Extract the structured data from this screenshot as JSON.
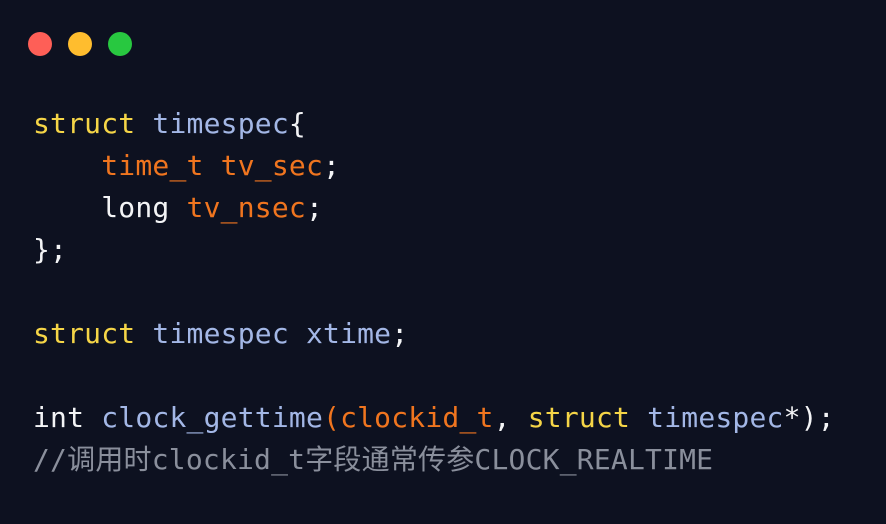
{
  "window": {
    "buttons": [
      {
        "name": "close",
        "color": "#fe5f57"
      },
      {
        "name": "minimize",
        "color": "#ffbd2e"
      },
      {
        "name": "maximize",
        "color": "#28c840"
      }
    ]
  },
  "code": {
    "colors": {
      "keyword": "#f5d547",
      "type": "#a3b7e6",
      "identifier": "#f0751f",
      "plain": "#f3f4f6",
      "comment": "#8a8f9c",
      "background": "#0d1120"
    },
    "lines": [
      {
        "tokens": [
          "struct",
          " ",
          "timespec",
          "{"
        ]
      },
      {
        "tokens": [
          "    ",
          "time_t",
          " ",
          "tv_sec",
          ";"
        ]
      },
      {
        "tokens": [
          "    ",
          "long",
          " ",
          "tv_nsec",
          ";"
        ]
      },
      {
        "tokens": [
          "};"
        ]
      },
      {
        "tokens": []
      },
      {
        "tokens": [
          "struct",
          " ",
          "timespec",
          " ",
          "xtime",
          ";"
        ]
      },
      {
        "tokens": []
      },
      {
        "tokens": [
          "int",
          " ",
          "clock_gettime",
          "(",
          "clockid_t",
          ", ",
          "struct",
          " ",
          "timespec",
          "*);"
        ]
      },
      {
        "tokens": [
          "//调用时clockid_t字段通常传参CLOCK_REALTIME"
        ]
      }
    ]
  }
}
